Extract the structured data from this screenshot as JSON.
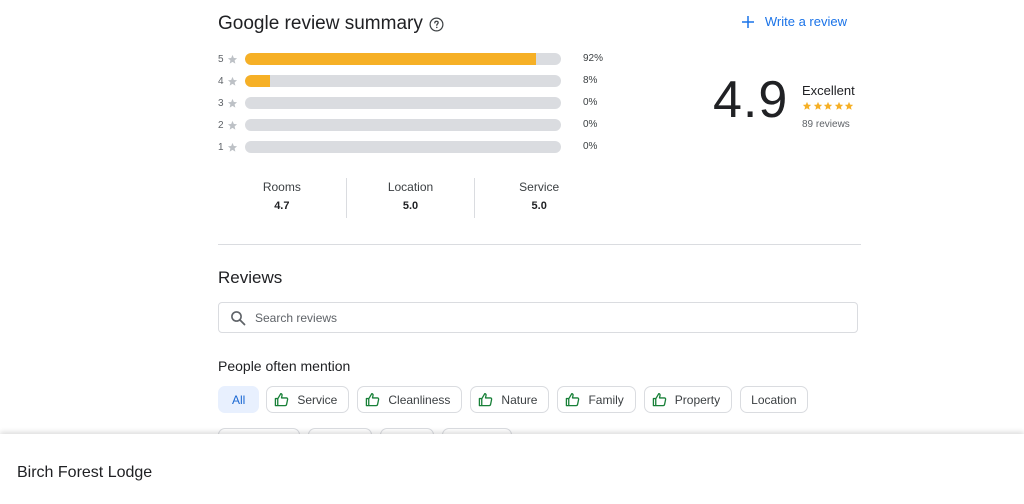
{
  "summary": {
    "title": "Google review summary",
    "write_review_label": "Write a review",
    "distribution": [
      {
        "stars": "5",
        "percent_label": "92%",
        "fraction": 0.92
      },
      {
        "stars": "4",
        "percent_label": "8%",
        "fraction": 0.08
      },
      {
        "stars": "3",
        "percent_label": "0%",
        "fraction": 0
      },
      {
        "stars": "2",
        "percent_label": "0%",
        "fraction": 0
      },
      {
        "stars": "1",
        "percent_label": "0%",
        "fraction": 0
      }
    ],
    "overall_score": "4.9",
    "rating_word": "Excellent",
    "star_rating": 5,
    "review_count": "89 reviews",
    "categories": [
      {
        "name": "Rooms",
        "value": "4.7"
      },
      {
        "name": "Location",
        "value": "5.0"
      },
      {
        "name": "Service",
        "value": "5.0"
      }
    ]
  },
  "reviews": {
    "title": "Reviews",
    "search_placeholder": "Search reviews",
    "mention_title": "People often mention",
    "chips": [
      {
        "label": "All",
        "active": true,
        "icon": null
      },
      {
        "label": "Service",
        "active": false,
        "icon": "thumbs-up-icon"
      },
      {
        "label": "Cleanliness",
        "active": false,
        "icon": "thumbs-up-icon"
      },
      {
        "label": "Nature",
        "active": false,
        "icon": "thumbs-up-icon"
      },
      {
        "label": "Family",
        "active": false,
        "icon": "thumbs-up-icon"
      },
      {
        "label": "Property",
        "active": false,
        "icon": "thumbs-up-icon"
      },
      {
        "label": "Location",
        "active": false,
        "icon": null
      }
    ]
  },
  "footer": {
    "hotel_name": "Birch Forest Lodge"
  },
  "colors": {
    "accent": "#1a73e8",
    "bar_fill": "#f6b026",
    "bar_track": "#dadce0",
    "star_gold": "#f6b026",
    "positive_green": "#188038",
    "active_chip_bg": "#e8f0fe"
  }
}
